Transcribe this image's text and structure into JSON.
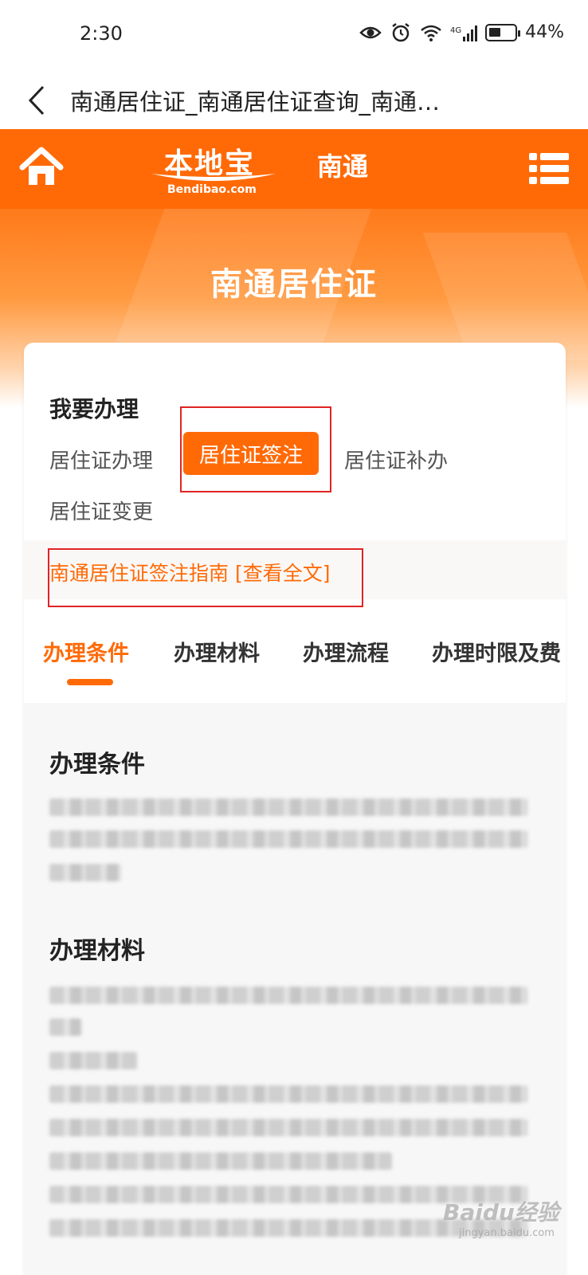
{
  "status_bar": {
    "time": "2:30",
    "network": "4G",
    "battery": "44%"
  },
  "browser": {
    "title": "南通居住证_南通居住证查询_南通…"
  },
  "header": {
    "logo_cn": "本地宝",
    "logo_en": "Bendibao.com",
    "city": "南通"
  },
  "banner": {
    "title": "南通居住证"
  },
  "services": {
    "section_label": "我要办理",
    "options": [
      {
        "label": "居住证办理",
        "selected": false
      },
      {
        "label": "居住证签注",
        "selected": true
      },
      {
        "label": "居住证补办",
        "selected": false
      },
      {
        "label": "居住证变更",
        "selected": false
      }
    ]
  },
  "guide": {
    "link_text": "南通居住证签注指南 [查看全文]"
  },
  "tabs": [
    {
      "label": "办理条件",
      "active": true
    },
    {
      "label": "办理材料",
      "active": false
    },
    {
      "label": "办理流程",
      "active": false
    },
    {
      "label": "办理时限及费",
      "active": false
    }
  ],
  "content": {
    "heading_1": "办理条件",
    "heading_2": "办理材料"
  },
  "watermark": {
    "brand": "Baidu经验",
    "url": "jingyan.baidu.com"
  },
  "colors": {
    "brand_orange": "#ff6a07",
    "annotation_red": "#e02424"
  }
}
